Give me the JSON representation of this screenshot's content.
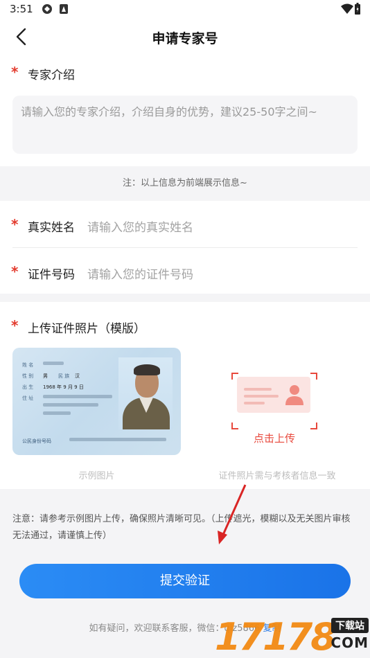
{
  "status_bar": {
    "time": "3:51"
  },
  "nav": {
    "title": "申请专家号"
  },
  "intro_section": {
    "required_mark": "*",
    "label": "专家介绍",
    "placeholder": "请输入您的专家介绍，介绍自身的优势，建议25-50字之间~"
  },
  "front_note": "注：以上信息为前端展示信息~",
  "identity_section": {
    "name_label": "真实姓名",
    "name_placeholder": "请输入您的真实姓名",
    "id_label": "证件号码",
    "id_placeholder": "请输入您的证件号码"
  },
  "upload_section": {
    "label": "上传证件照片（模版）",
    "sample_caption": "示例图片",
    "upload_text": "点击上传",
    "upload_caption": "证件照片需与考核者信息一致",
    "card_fields": {
      "gender": "男",
      "ethnicity": "汉",
      "birth": "1968 年 9 月 9 日",
      "id_label": "公民身份号码"
    }
  },
  "notice": "注意：请参考示例图片上传，确保照片清晰可见。（上传遮光，模糊以及无关图片审核无法通过，请谨慎上传）",
  "submit_label": "提交验证",
  "contact": {
    "text": "如有疑问，欢迎联系客服，微信：qiz5866",
    "copy": "复制"
  },
  "watermark": {
    "number": "17178",
    "tag": "下载站",
    "domain": "COM"
  },
  "colors": {
    "accent": "#1a73e8",
    "required": "#e33b2e",
    "upload": "#e8483c"
  }
}
